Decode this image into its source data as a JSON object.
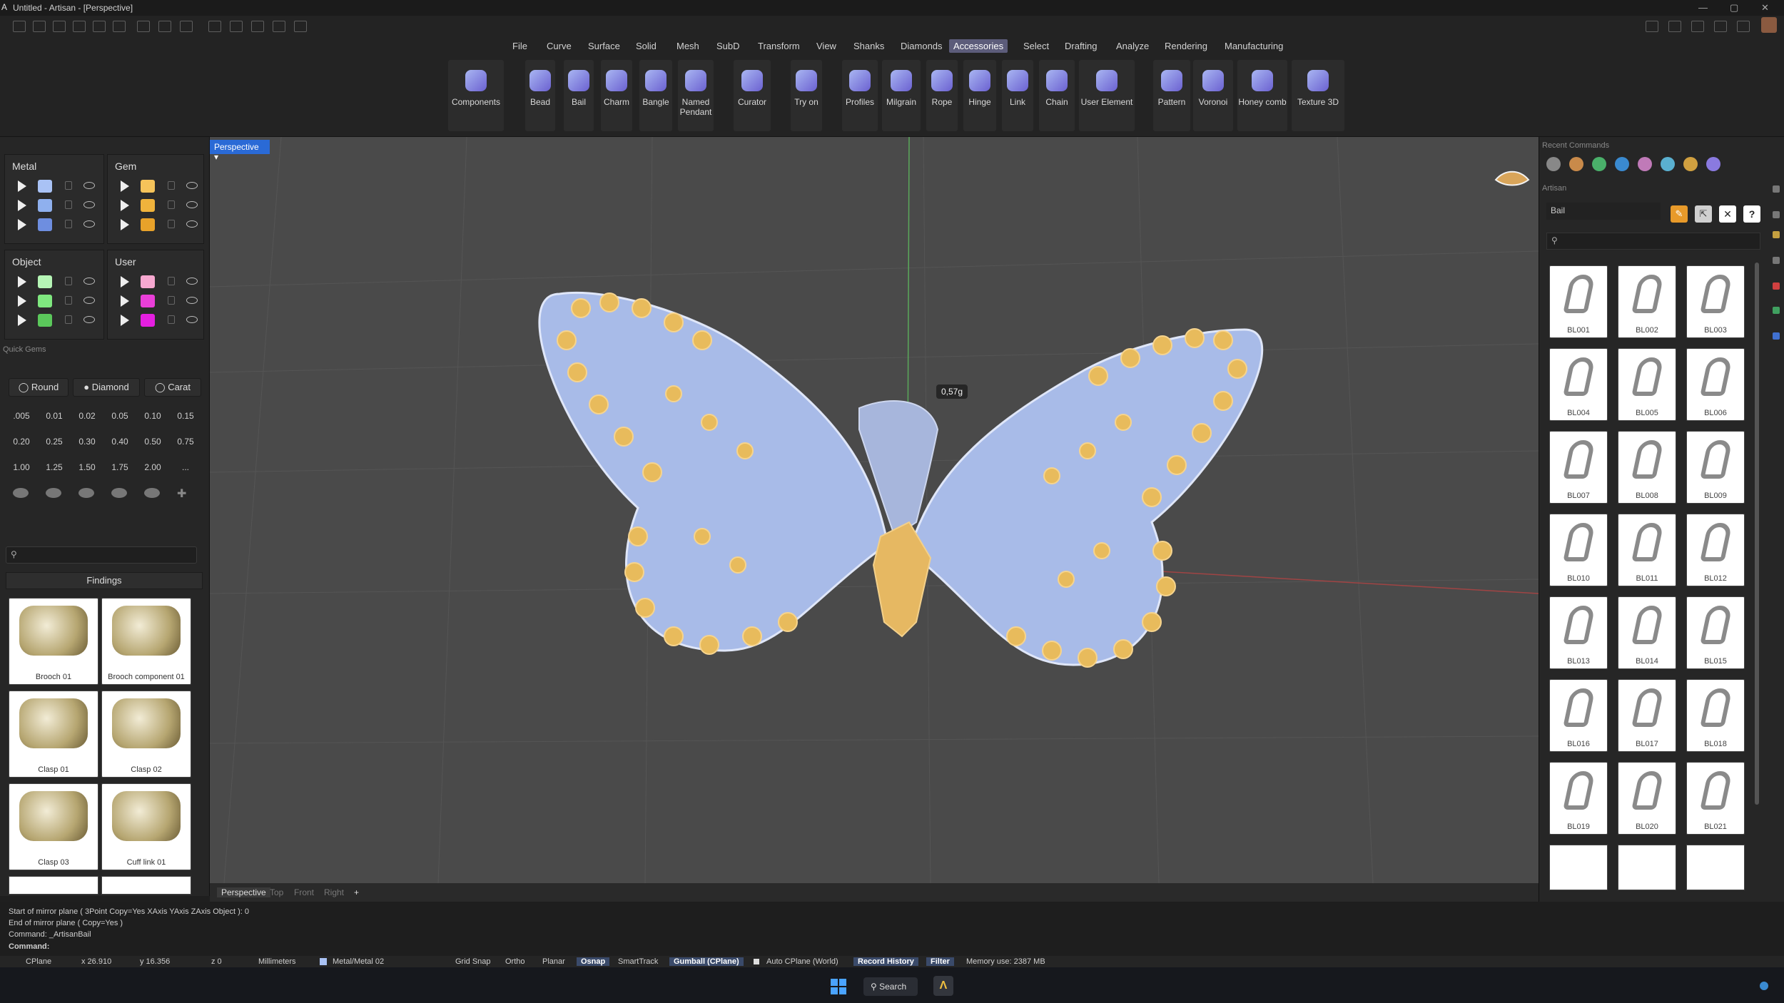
{
  "window": {
    "title": "Untitled - Artisan - [Perspective]"
  },
  "menu": {
    "items": [
      "File",
      "Curve",
      "Surface",
      "Solid",
      "Mesh",
      "SubD",
      "Transform",
      "View",
      "Shanks",
      "Diamonds",
      "Accessories",
      "Select",
      "Drafting",
      "Analyze",
      "Rendering",
      "Manufacturing"
    ],
    "active": "Accessories"
  },
  "ribbon": {
    "buttons": [
      {
        "label": "Components"
      },
      {
        "label": "Bead"
      },
      {
        "label": "Bail"
      },
      {
        "label": "Charm"
      },
      {
        "label": "Bangle"
      },
      {
        "label": "Named Pendant"
      },
      {
        "label": "Curator"
      },
      {
        "label": "Try on"
      },
      {
        "label": "Profiles"
      },
      {
        "label": "Milgrain"
      },
      {
        "label": "Rope"
      },
      {
        "label": "Hinge"
      },
      {
        "label": "Link"
      },
      {
        "label": "Chain"
      },
      {
        "label": "User Element"
      },
      {
        "label": "Pattern"
      },
      {
        "label": "Voronoi"
      },
      {
        "label": "Honey comb"
      },
      {
        "label": "Texture 3D"
      }
    ]
  },
  "layers": {
    "metal": {
      "title": "Metal",
      "colors": [
        "#a9c2f5",
        "#8fb0ee",
        "#6e8ee0"
      ]
    },
    "gem": {
      "title": "Gem",
      "colors": [
        "#f5c35a",
        "#f0b33c",
        "#e8a22a"
      ]
    },
    "object": {
      "title": "Object",
      "colors": [
        "#b5f5b5",
        "#7fe87f",
        "#5bc85b"
      ]
    },
    "user": {
      "title": "User",
      "colors": [
        "#f7a8d0",
        "#ea3fd8",
        "#e51fe0"
      ]
    }
  },
  "quickgems": {
    "title": "Quick Gems",
    "shape": "Round",
    "type": "Diamond",
    "unit": "Carat",
    "sizes": [
      ".005",
      "0.01",
      "0.02",
      "0.05",
      "0.10",
      "0.15",
      "0.20",
      "0.25",
      "0.30",
      "0.40",
      "0.50",
      "0.75",
      "1.00",
      "1.25",
      "1.50",
      "1.75",
      "2.00",
      "..."
    ]
  },
  "findings": {
    "category": "Findings",
    "items": [
      "Brooch 01",
      "Brooch component 01",
      "Clasp 01",
      "Clasp 02",
      "Clasp 03",
      "Cuff link 01"
    ]
  },
  "viewport": {
    "name": "Perspective",
    "weight_tag": "0,57g",
    "tabs": [
      "Perspective",
      "Top",
      "Front",
      "Right"
    ],
    "add_tab": "+"
  },
  "recent": {
    "title": "Recent Commands"
  },
  "artisan": {
    "title": "Artisan",
    "field": "Bail",
    "help": "?",
    "bails": [
      "BL001",
      "BL002",
      "BL003",
      "BL004",
      "BL005",
      "BL006",
      "BL007",
      "BL008",
      "BL009",
      "BL010",
      "BL011",
      "BL012",
      "BL013",
      "BL014",
      "BL015",
      "BL016",
      "BL017",
      "BL018",
      "BL019",
      "BL020",
      "BL021"
    ]
  },
  "command": {
    "lines": [
      "Start of mirror plane ( 3Point  Copy=Yes  XAxis  YAxis  ZAxis  Object ): 0",
      "End of mirror plane ( Copy=Yes )",
      "Command: _ArtisanBail"
    ],
    "prompt": "Command:"
  },
  "status": {
    "cplane": "CPlane",
    "x": "x 26.910",
    "y": "y 16.356",
    "z": "z 0",
    "units": "Millimeters",
    "layer": "Metal/Metal 02",
    "toggles": [
      "Grid Snap",
      "Ortho",
      "Planar",
      "Osnap",
      "SmartTrack",
      "Gumball (CPlane)",
      "Auto CPlane (World)",
      "Record History",
      "Filter"
    ],
    "memory": "Memory use: 2387 MB"
  },
  "taskbar": {
    "search": "Search"
  }
}
